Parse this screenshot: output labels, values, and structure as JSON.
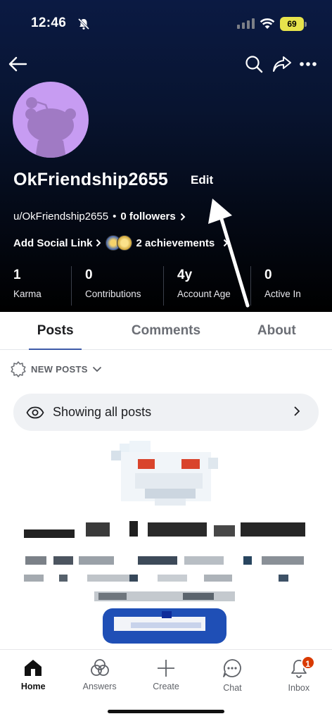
{
  "status_bar": {
    "time": "12:46",
    "battery": "69"
  },
  "profile": {
    "username": "OkFriendship2655",
    "edit_label": "Edit",
    "handle": "u/OkFriendship2655",
    "separator": "•",
    "followers": "0 followers",
    "social_link_label": "Add Social Link",
    "achievements": "2 achievements"
  },
  "stats": [
    {
      "value": "1",
      "label": "Karma"
    },
    {
      "value": "0",
      "label": "Contributions"
    },
    {
      "value": "4y",
      "label": "Account Age"
    },
    {
      "value": "0",
      "label": "Active In"
    }
  ],
  "tabs": [
    "Posts",
    "Comments",
    "About"
  ],
  "sort": {
    "label": "NEW POSTS"
  },
  "filter": {
    "label": "Showing all posts"
  },
  "bottom_nav": [
    {
      "label": "Home",
      "icon": "home-icon"
    },
    {
      "label": "Answers",
      "icon": "answers-icon"
    },
    {
      "label": "Create",
      "icon": "plus-icon"
    },
    {
      "label": "Chat",
      "icon": "chat-icon"
    },
    {
      "label": "Inbox",
      "icon": "bell-icon",
      "badge": "1"
    }
  ],
  "colors": {
    "accent": "#3d5aa8",
    "avatar_bg": "#c79cf2",
    "badge": "#d93a00",
    "header_top": "#0b1a43"
  }
}
